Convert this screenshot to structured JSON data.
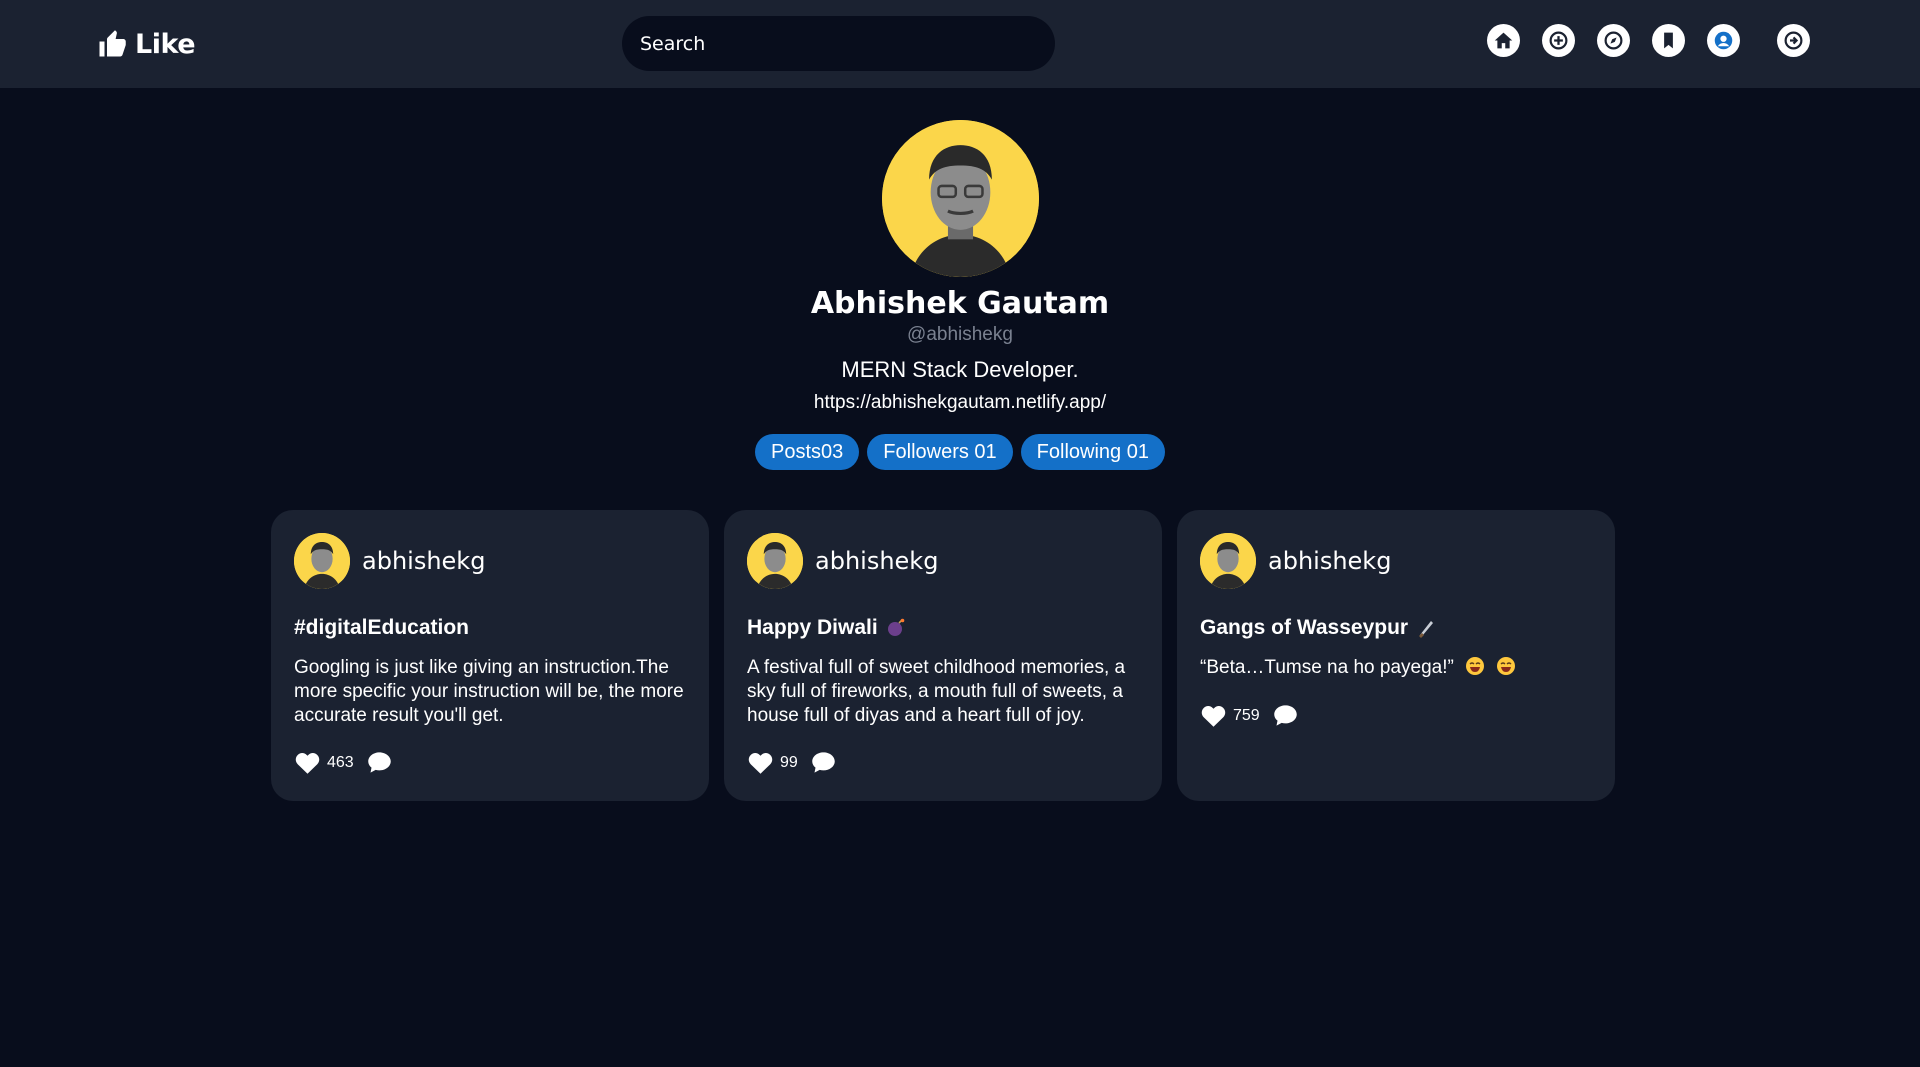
{
  "app": {
    "brand": "Like",
    "search_placeholder": "Search"
  },
  "nav": [
    {
      "name": "home-icon"
    },
    {
      "name": "add-post-icon"
    },
    {
      "name": "explore-icon"
    },
    {
      "name": "bookmark-icon"
    },
    {
      "name": "profile-icon"
    },
    {
      "name": "logout-icon"
    }
  ],
  "profile": {
    "name": "Abhishek Gautam",
    "handle": "@abhishekg",
    "bio": "MERN Stack Developer.",
    "link": "https://abhishekgautam.netlify.app/",
    "stats": {
      "posts": "Posts03",
      "followers": "Followers 01",
      "following": "Following 01"
    }
  },
  "posts": [
    {
      "user": "abhishekg",
      "title": "#digitalEducation",
      "body": "Googling is just like giving an instruction.The more specific your instruction will be, the more accurate result you'll get.",
      "likes": "463"
    },
    {
      "user": "abhishekg",
      "title": "Happy Diwali",
      "title_emoji": "firecracker-emoji",
      "body": "A festival full of sweet childhood memories, a sky full of fireworks, a mouth full of sweets, a house full of diyas and a heart full of joy.",
      "likes": "99"
    },
    {
      "user": "abhishekg",
      "title": "Gangs of Wasseypur",
      "title_emoji": "knife-emoji",
      "body": "“Beta…Tumse na ho payega!”",
      "body_emoji": "laughing-emoji",
      "likes": "759"
    }
  ],
  "colors": {
    "background": "#080d1c",
    "surface": "#1b2231",
    "accent": "#1470c8",
    "avatar_bg": "#fbd64a"
  }
}
